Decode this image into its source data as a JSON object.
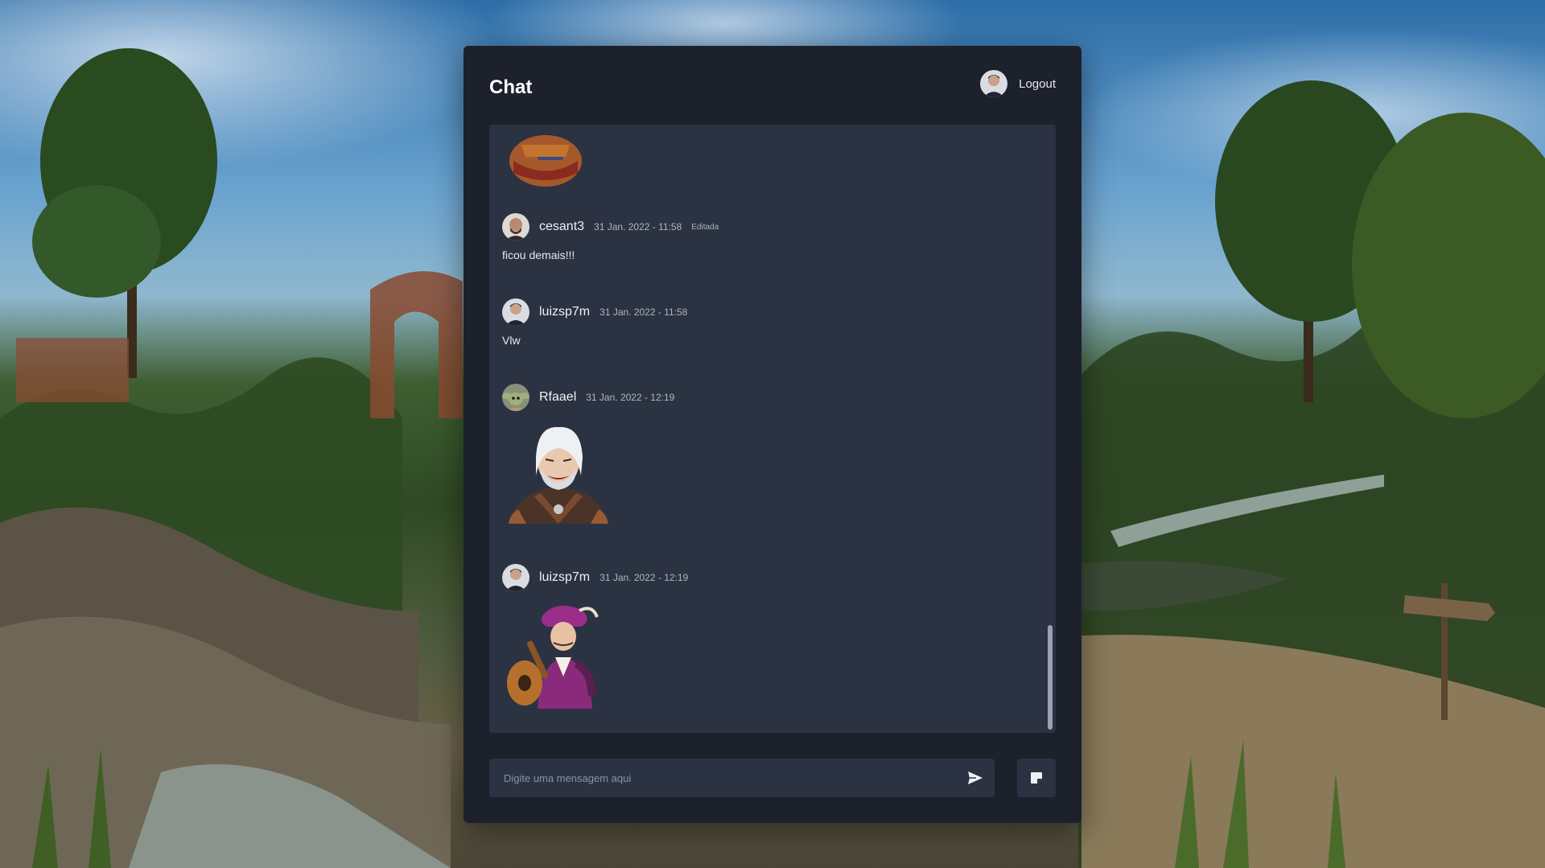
{
  "header": {
    "title": "Chat",
    "logout_label": "Logout",
    "current_user_avatar": "user-avatar-icon"
  },
  "messages": [
    {
      "author": "cesant3",
      "timestamp": "31 Jan. 2022 - 11:58",
      "edited_label": "Editada",
      "text": "ficou demais!!!",
      "avatar": "user-avatar-icon"
    },
    {
      "author": "luizsp7m",
      "timestamp": "31 Jan. 2022 - 11:58",
      "text": "Vlw",
      "avatar": "user-avatar-icon"
    },
    {
      "author": "Rfaael",
      "timestamp": "31 Jan. 2022 - 12:19",
      "sticker": "geralt-sticker",
      "avatar": "user-avatar-icon"
    },
    {
      "author": "luizsp7m",
      "timestamp": "31 Jan. 2022 - 12:19",
      "sticker": "dandelion-sticker",
      "avatar": "user-avatar-icon"
    }
  ],
  "composer": {
    "placeholder": "Digite uma mensagem aqui",
    "value": "",
    "send_icon": "send-icon",
    "sticker_icon": "sticker-icon"
  },
  "colors": {
    "panel_bg": "#1c212c",
    "list_bg": "#2b3242",
    "text_primary": "#eef1f6",
    "text_muted": "#aeb5c2"
  }
}
